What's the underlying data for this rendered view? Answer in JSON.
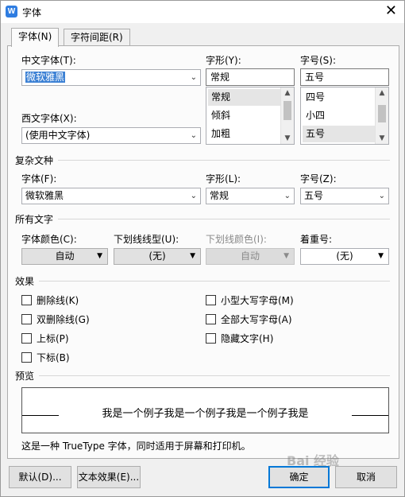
{
  "window": {
    "title": "字体",
    "close_symbol": "✕"
  },
  "tabs": [
    {
      "label": "字体(N)",
      "active": true
    },
    {
      "label": "字符间距(R)",
      "active": false
    }
  ],
  "chinese_font": {
    "label": "中文字体(T):",
    "value": "微软雅黑"
  },
  "western_font": {
    "label": "西文字体(X):",
    "value": "(使用中文字体)"
  },
  "style": {
    "label": "字形(Y):",
    "value": "常规",
    "options": [
      "常规",
      "倾斜",
      "加粗"
    ],
    "selected_index": 0
  },
  "size": {
    "label": "字号(S):",
    "value": "五号",
    "options": [
      "四号",
      "小四",
      "五号"
    ],
    "selected_index": 2
  },
  "complex": {
    "section_title": "复杂文种",
    "font_label": "字体(F):",
    "font_value": "微软雅黑",
    "style_label": "字形(L):",
    "style_value": "常规",
    "size_label": "字号(Z):",
    "size_value": "五号"
  },
  "all_text": {
    "section_title": "所有文字",
    "font_color_label": "字体颜色(C):",
    "font_color_value": "自动",
    "underline_type_label": "下划线线型(U):",
    "underline_type_value": "(无)",
    "underline_color_label": "下划线颜色(I):",
    "underline_color_value": "自动",
    "emphasis_label": "着重号:",
    "emphasis_value": "(无)"
  },
  "effects": {
    "section_title": "效果",
    "left": [
      "删除线(K)",
      "双删除线(G)",
      "上标(P)",
      "下标(B)"
    ],
    "right": [
      "小型大写字母(M)",
      "全部大写字母(A)",
      "隐藏文字(H)"
    ]
  },
  "preview": {
    "section_title": "预览",
    "sample_text": "我是一个例子我是一个例子我是一个例子我是",
    "description": "这是一种 TrueType 字体，同时适用于屏幕和打印机。"
  },
  "buttons": {
    "default": "默认(D)...",
    "text_effects": "文本效果(E)...",
    "ok": "确定",
    "cancel": "取消"
  },
  "watermark_text": "Bai 经验",
  "colors": {
    "selection": "#3b80d4",
    "primary_border": "#0078d7",
    "app_icon": "#2f7de1"
  }
}
